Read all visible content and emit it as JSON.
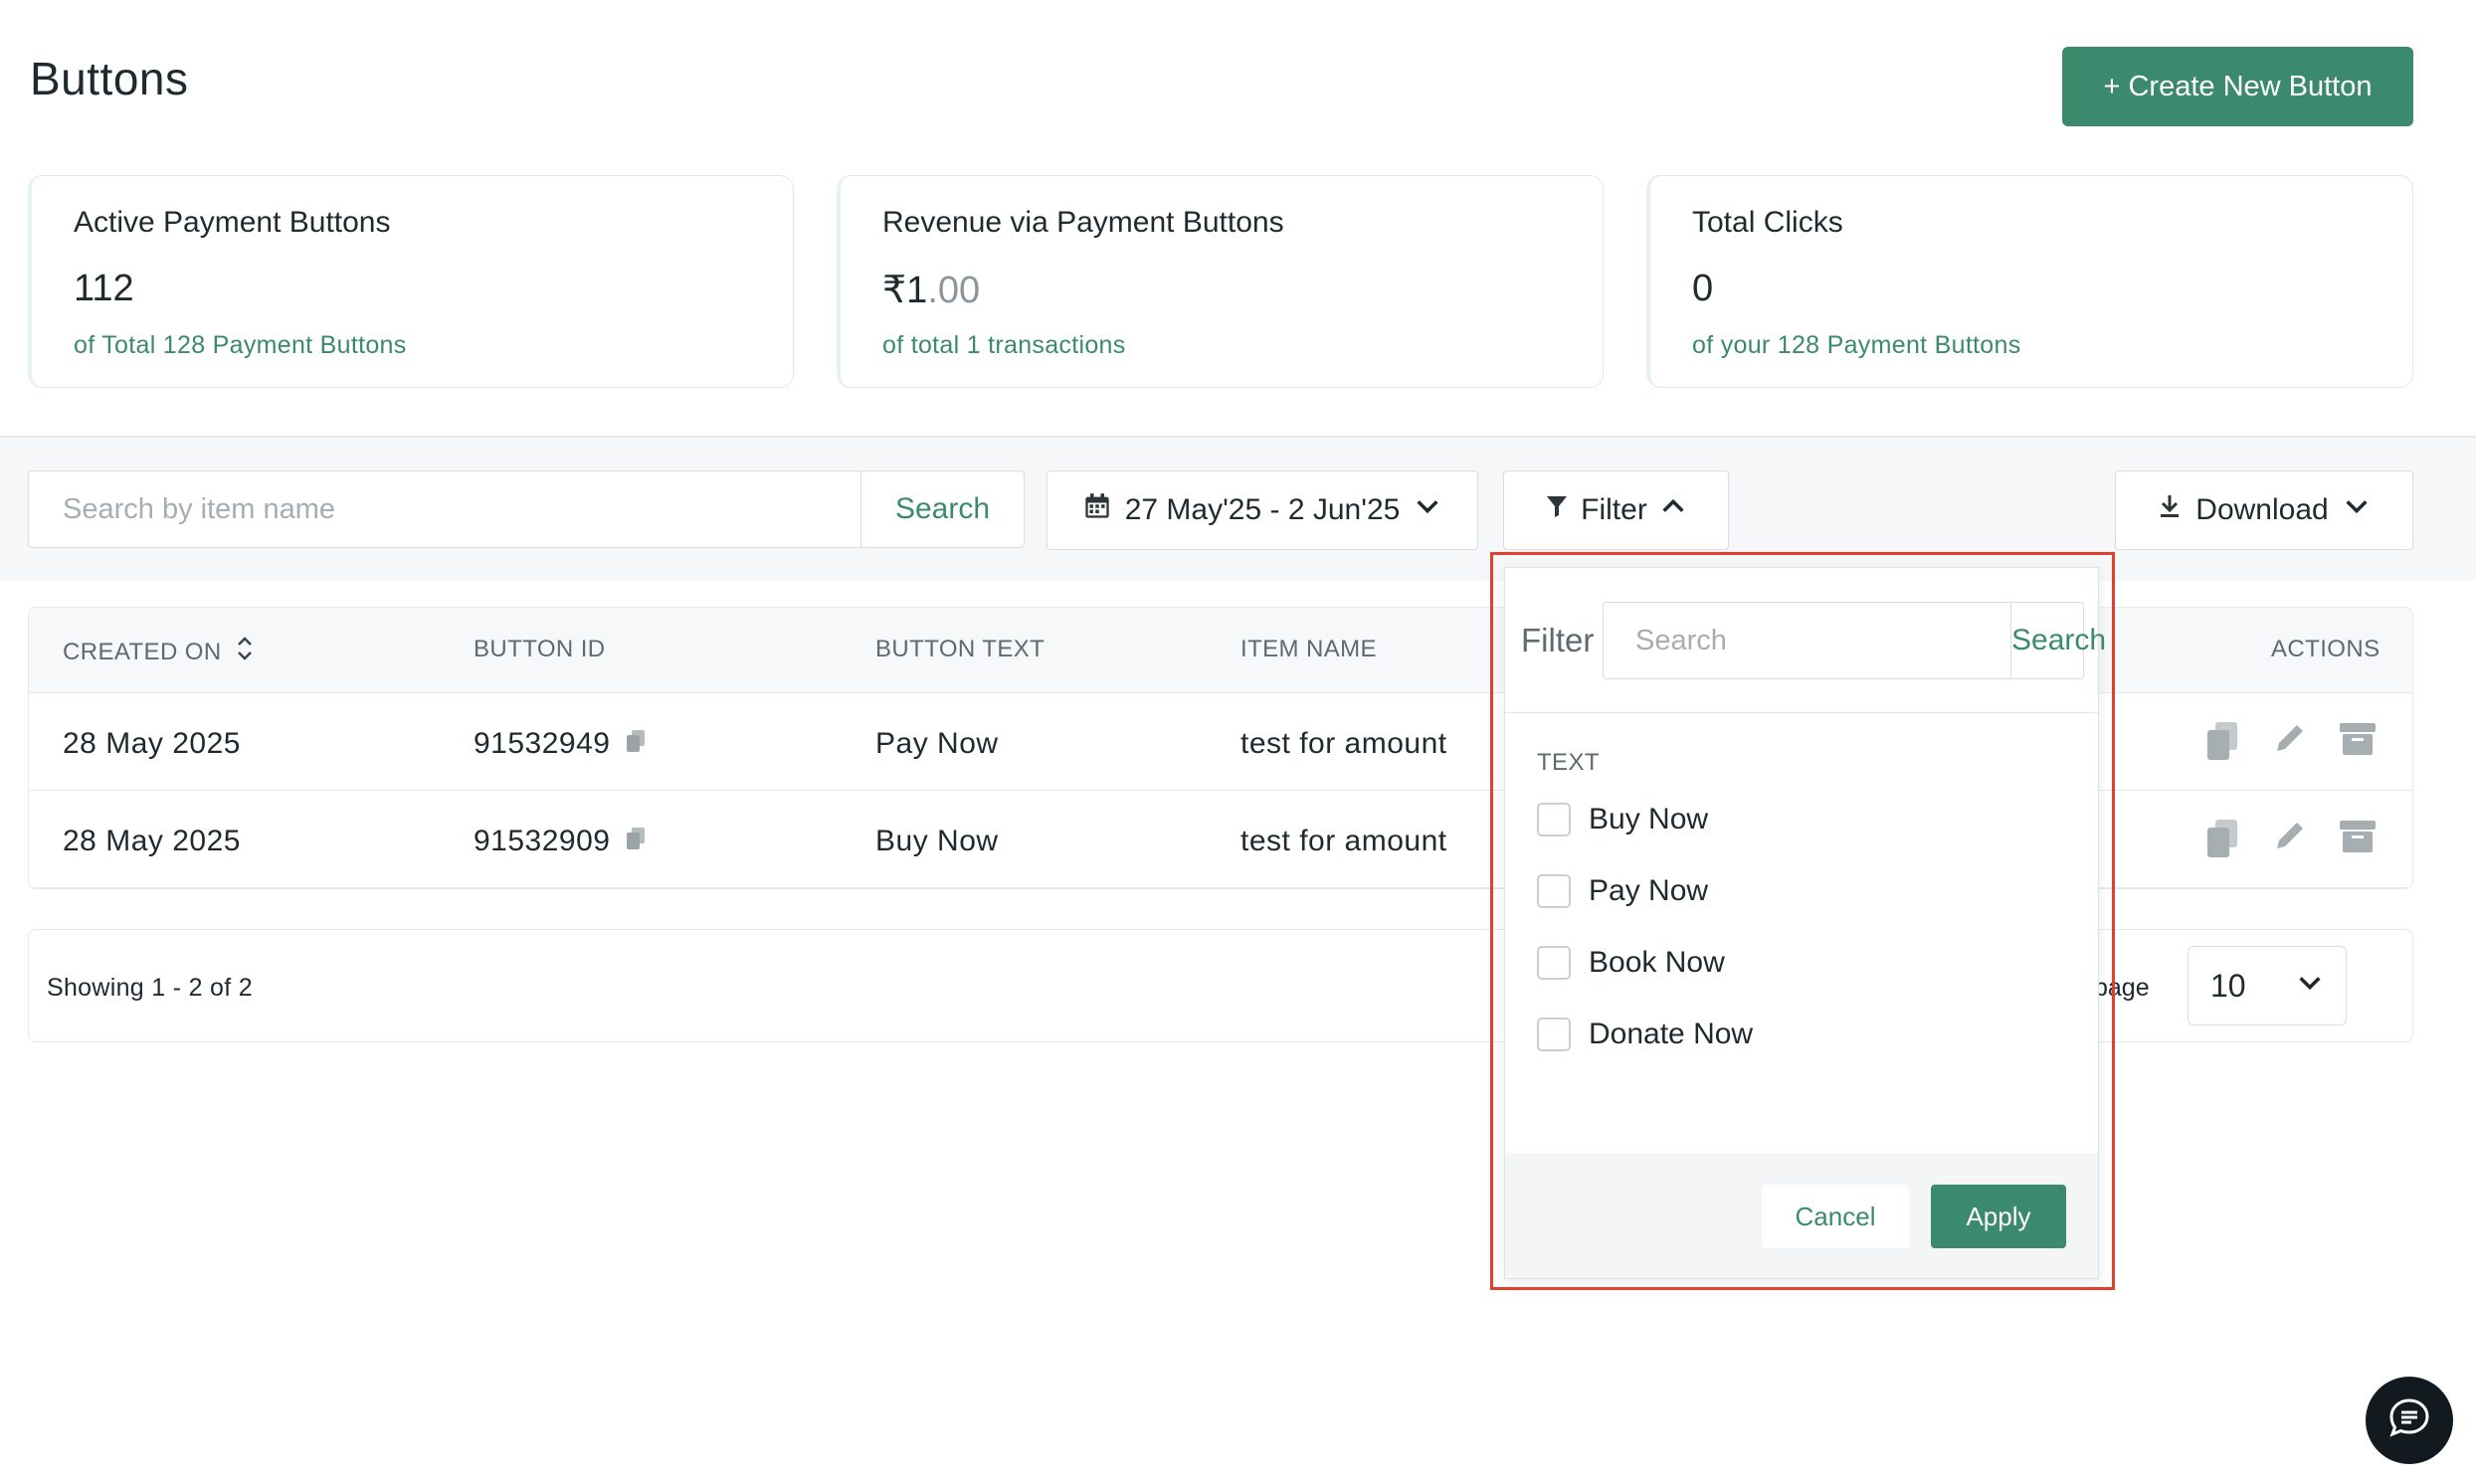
{
  "header": {
    "title": "Buttons",
    "create_label": "+ Create New Button"
  },
  "stats": [
    {
      "title": "Active Payment Buttons",
      "value": "112",
      "value_decimal": "",
      "sub": "of Total 128 Payment Buttons"
    },
    {
      "title": "Revenue via Payment Buttons",
      "value": "₹1",
      "value_decimal": ".00",
      "sub": "of total 1 transactions"
    },
    {
      "title": "Total Clicks",
      "value": "0",
      "value_decimal": "",
      "sub": "of your 128 Payment Buttons"
    }
  ],
  "toolbar": {
    "search_placeholder": "Search by item name",
    "search_label": "Search",
    "date_range": "27 May'25 - 2 Jun'25",
    "filter_label": "Filter",
    "download_label": "Download"
  },
  "table": {
    "columns": [
      "CREATED ON",
      "BUTTON ID",
      "BUTTON TEXT",
      "ITEM NAME",
      "ACTIONS"
    ],
    "rows": [
      {
        "created_on": "28 May 2025",
        "button_id": "91532949",
        "button_text": "Pay Now",
        "item_name": "test for amount"
      },
      {
        "created_on": "28 May 2025",
        "button_id": "91532909",
        "button_text": "Buy Now",
        "item_name": "test for amount"
      }
    ]
  },
  "pagination": {
    "showing": "Showing 1 - 2 of 2",
    "per_page_label": "page",
    "per_page_value": "10"
  },
  "filter_dropdown": {
    "label": "Filter",
    "search_placeholder": "Search",
    "search_label": "Search",
    "section": "TEXT",
    "options": [
      "Buy Now",
      "Pay Now",
      "Book Now",
      "Donate Now"
    ],
    "cancel_label": "Cancel",
    "apply_label": "Apply"
  },
  "colors": {
    "accent": "#3b8a6e",
    "highlight": "#e0412e"
  }
}
